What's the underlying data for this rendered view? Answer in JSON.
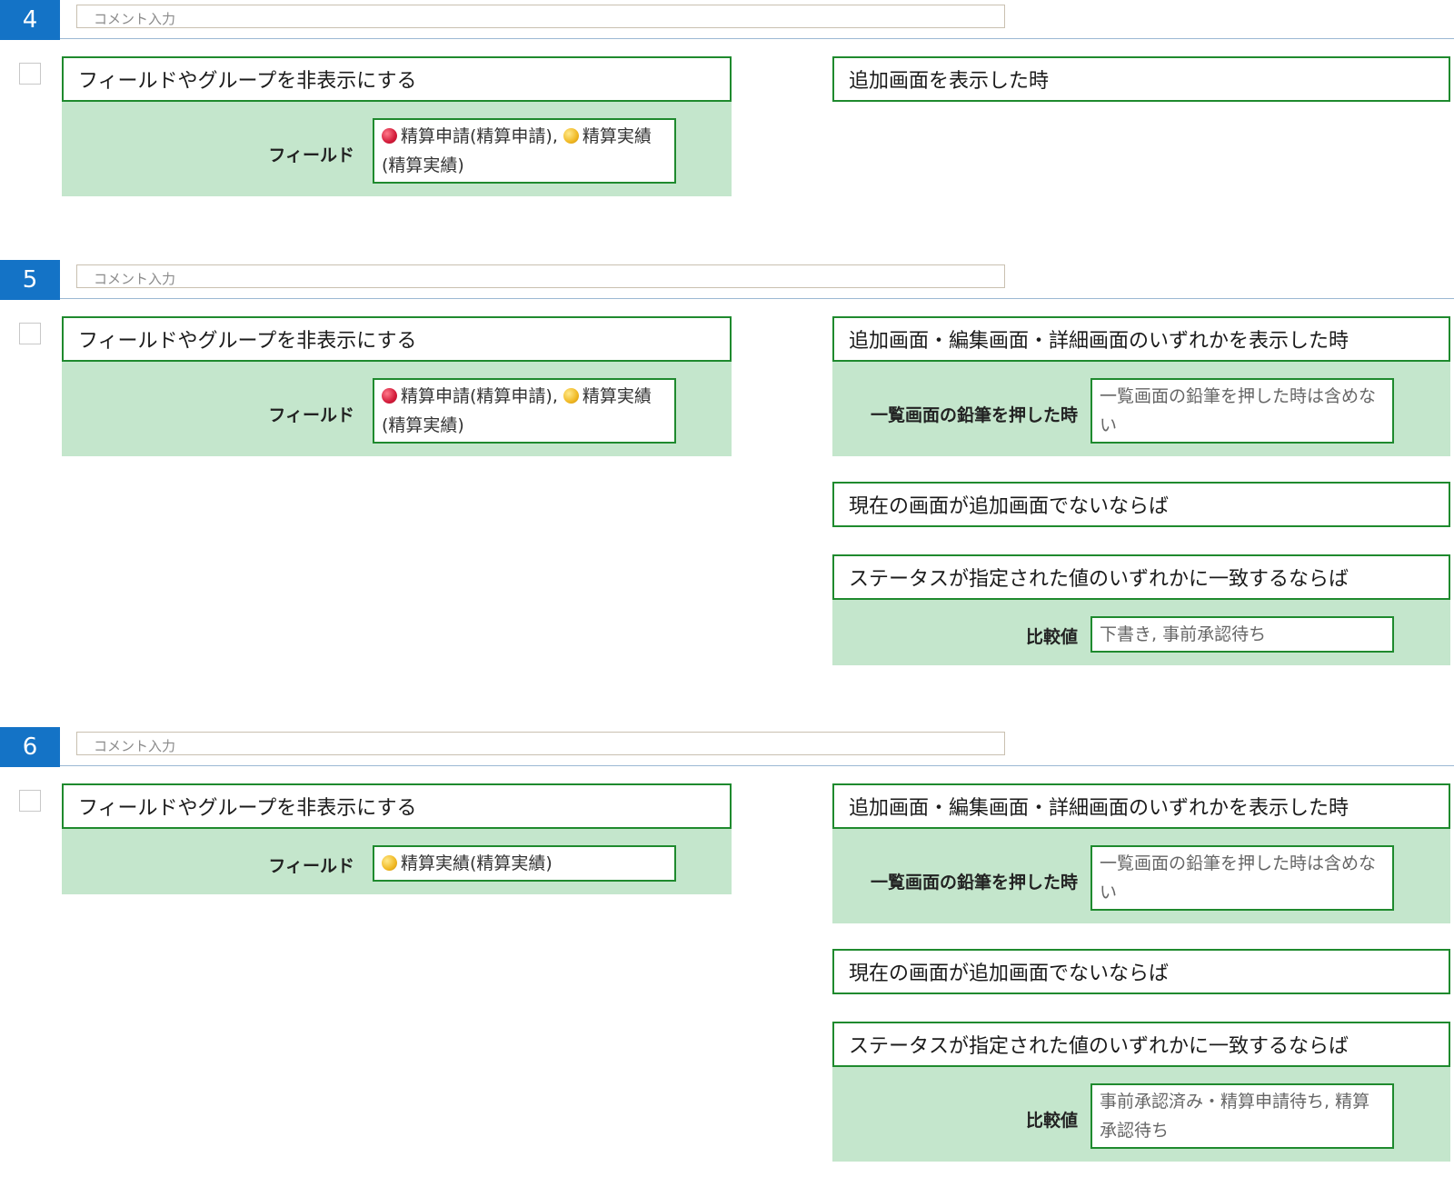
{
  "comment_placeholder": "コメント入力",
  "rules": [
    {
      "number": "4",
      "action": {
        "title": "フィールドやグループを非表示にする",
        "field_label": "フィールド",
        "fields": [
          {
            "icon": "red-dot-icon",
            "color": "#d31b3a",
            "text": "精算申請(精算申請), "
          },
          {
            "icon": "yellow-dot-icon",
            "color": "#f0b823",
            "text": "精算実績(精算実績)"
          }
        ]
      },
      "conditions": [
        {
          "title": "追加画面を表示した時"
        }
      ]
    },
    {
      "number": "5",
      "action": {
        "title": "フィールドやグループを非表示にする",
        "field_label": "フィールド",
        "fields": [
          {
            "icon": "red-dot-icon",
            "color": "#d31b3a",
            "text": "精算申請(精算申請), "
          },
          {
            "icon": "yellow-dot-icon",
            "color": "#f0b823",
            "text": "精算実績(精算実績)"
          }
        ]
      },
      "conditions": [
        {
          "title": "追加画面・編集画面・詳細画面のいずれかを表示した時",
          "param_label": "一覧画面の鉛筆を押した時",
          "param_value": "一覧画面の鉛筆を押した時は含めない"
        },
        {
          "title": "現在の画面が追加画面でないならば"
        },
        {
          "title": "ステータスが指定された値のいずれかに一致するならば",
          "param_label": "比較値",
          "param_value": "下書き, 事前承認待ち"
        }
      ]
    },
    {
      "number": "6",
      "action": {
        "title": "フィールドやグループを非表示にする",
        "field_label": "フィールド",
        "fields": [
          {
            "icon": "yellow-dot-icon",
            "color": "#f0b823",
            "text": "精算実績(精算実績)"
          }
        ]
      },
      "conditions": [
        {
          "title": "追加画面・編集画面・詳細画面のいずれかを表示した時",
          "param_label": "一覧画面の鉛筆を押した時",
          "param_value": "一覧画面の鉛筆を押した時は含めない"
        },
        {
          "title": "現在の画面が追加画面でないならば"
        },
        {
          "title": "ステータスが指定された値のいずれかに一致するならば",
          "param_label": "比較値",
          "param_value": "事前承認済み・精算申請待ち, 精算承認待ち"
        }
      ]
    }
  ]
}
